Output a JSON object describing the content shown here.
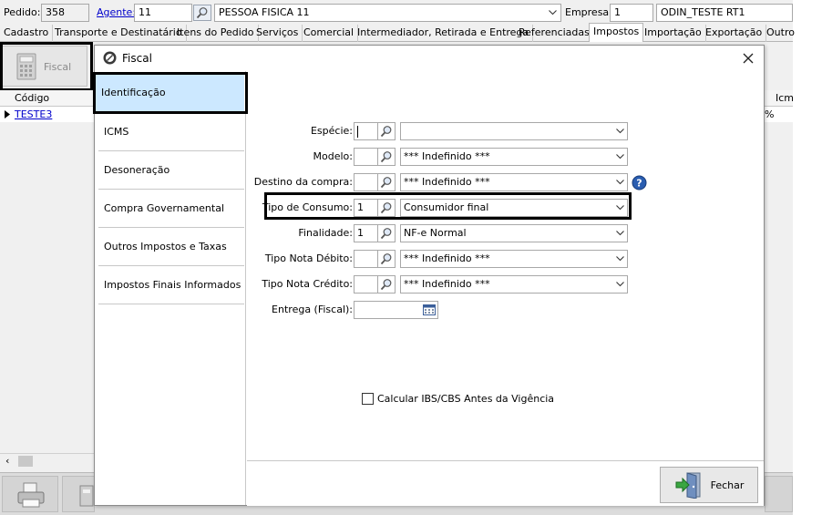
{
  "header": {
    "pedido_label": "Pedido:",
    "pedido_value": "358",
    "agente_label": "Agente:",
    "agente_value": "11",
    "agente_name": "PESSOA FISICA 11",
    "empresa_label": "Empresa:",
    "empresa_value": "1",
    "empresa_name": "ODIN_TESTE RT1"
  },
  "tabs": [
    {
      "label": "Cadastro"
    },
    {
      "label": "Transporte e Destinatário"
    },
    {
      "label": "Itens do Pedido"
    },
    {
      "label": "Serviços"
    },
    {
      "label": "Comercial"
    },
    {
      "label": "Intermediador, Retirada e Entrega"
    },
    {
      "label": "Referenciadas"
    },
    {
      "label": "Impostos"
    },
    {
      "label": "Importação"
    },
    {
      "label": "Exportação"
    },
    {
      "label": "Outro"
    }
  ],
  "active_tab": "Impostos",
  "toolbar": {
    "fiscal_label": "Fiscal"
  },
  "grid": {
    "col_codigo": "Código",
    "col_icm": "Icm",
    "row_codigo": "TESTE3",
    "row_pct": "%"
  },
  "modal": {
    "title": "Fiscal",
    "nav": [
      {
        "label": "Identificação"
      },
      {
        "label": "ICMS"
      },
      {
        "label": "Desoneração"
      },
      {
        "label": "Compra Governamental"
      },
      {
        "label": "Outros Impostos e Taxas"
      },
      {
        "label": "Impostos Finais Informados"
      }
    ],
    "fields": {
      "especie": {
        "label": "Espécie:",
        "code": "",
        "value": ""
      },
      "modelo": {
        "label": "Modelo:",
        "code": "",
        "value": "*** Indefinido ***"
      },
      "destino": {
        "label": "Destino da compra:",
        "code": "",
        "value": "*** Indefinido ***"
      },
      "tipo_consumo": {
        "label": "Tipo de Consumo:",
        "code": "1",
        "value": "Consumidor final"
      },
      "finalidade": {
        "label": "Finalidade:",
        "code": "1",
        "value": "NF-e Normal"
      },
      "nota_debito": {
        "label": "Tipo Nota Débito:",
        "code": "",
        "value": "*** Indefinido ***"
      },
      "nota_credito": {
        "label": "Tipo Nota Crédito:",
        "code": "",
        "value": "*** Indefinido ***"
      },
      "entrega": {
        "label": "Entrega (Fiscal):",
        "value": ""
      }
    },
    "checkbox_label": "Calcular IBS/CBS Antes da Vigência",
    "close_label": "Fechar"
  },
  "colors": {
    "nav_active": "#cce8ff",
    "link": "#0000cc",
    "help_icon": "#2a5db0"
  }
}
